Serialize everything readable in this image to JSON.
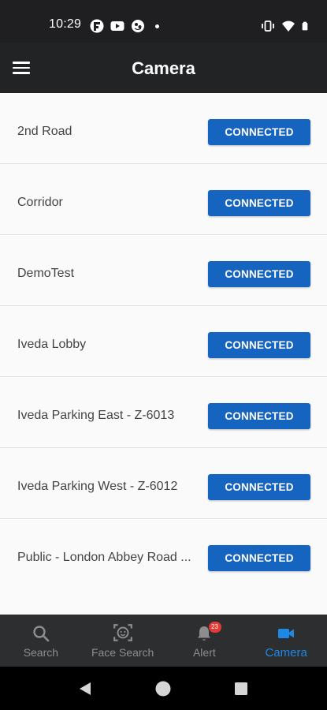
{
  "status_bar": {
    "time": "10:29",
    "left_icons": [
      "flipboard-icon",
      "youtube-icon",
      "app-icon"
    ],
    "right_icons": [
      "vibrate-icon",
      "wifi-icon",
      "battery-icon"
    ]
  },
  "app_bar": {
    "title": "Camera",
    "menu_icon": "hamburger-menu-icon"
  },
  "cameras": [
    {
      "name": "2nd Road",
      "status": "CONNECTED"
    },
    {
      "name": "Corridor",
      "status": "CONNECTED"
    },
    {
      "name": "DemoTest",
      "status": "CONNECTED"
    },
    {
      "name": "Iveda Lobby",
      "status": "CONNECTED"
    },
    {
      "name": "Iveda Parking East - Z-6013",
      "status": "CONNECTED"
    },
    {
      "name": "Iveda Parking West - Z-6012",
      "status": "CONNECTED"
    },
    {
      "name": "Public - London Abbey Road ...",
      "status": "CONNECTED"
    }
  ],
  "bottom_nav": {
    "items": [
      {
        "label": "Search",
        "icon": "search-icon",
        "active": false
      },
      {
        "label": "Face Search",
        "icon": "face-scan-icon",
        "active": false
      },
      {
        "label": "Alert",
        "icon": "bell-icon",
        "badge": "23",
        "active": false
      },
      {
        "label": "Camera",
        "icon": "video-camera-icon",
        "active": true
      }
    ]
  },
  "colors": {
    "accent": "#1565c0",
    "active_nav": "#1e88e5",
    "badge": "#e53935",
    "bar_background": "#222325"
  }
}
